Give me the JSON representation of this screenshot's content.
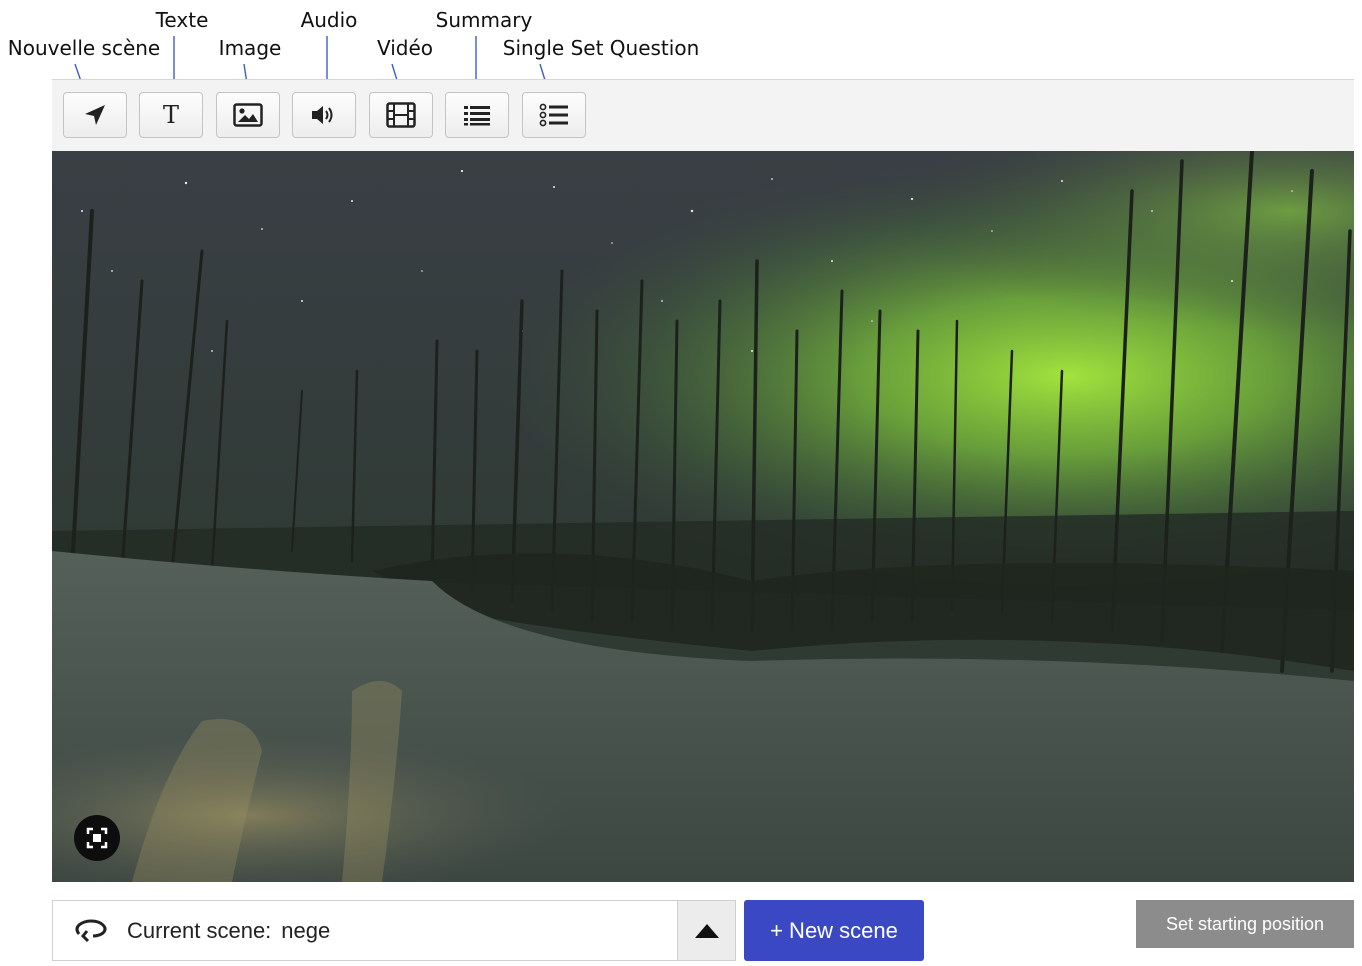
{
  "annotations": {
    "nouvelle_scene": "Nouvelle scène",
    "texte": "Texte",
    "image": "Image",
    "audio": "Audio",
    "video": "Vidéo",
    "summary": "Summary",
    "single_set_question": "Single Set Question"
  },
  "toolbar": {
    "buttons": [
      {
        "icon": "navigation-arrow-icon"
      },
      {
        "icon": "text-icon",
        "glyph": "T"
      },
      {
        "icon": "image-icon"
      },
      {
        "icon": "audio-icon"
      },
      {
        "icon": "film-icon"
      },
      {
        "icon": "list-icon"
      },
      {
        "icon": "checklist-icon"
      }
    ]
  },
  "bottom_bar": {
    "current_scene_label": "Current scene:",
    "current_scene_value": "nege",
    "new_scene_label": "+ New scene",
    "set_starting_position_label": "Set starting position"
  },
  "colors": {
    "annotation_arrow": "#3d5ec7",
    "new_scene_bg": "#3a48c4",
    "start_position_bg": "#8c8c8c",
    "aurora_green": "#9be23a"
  }
}
